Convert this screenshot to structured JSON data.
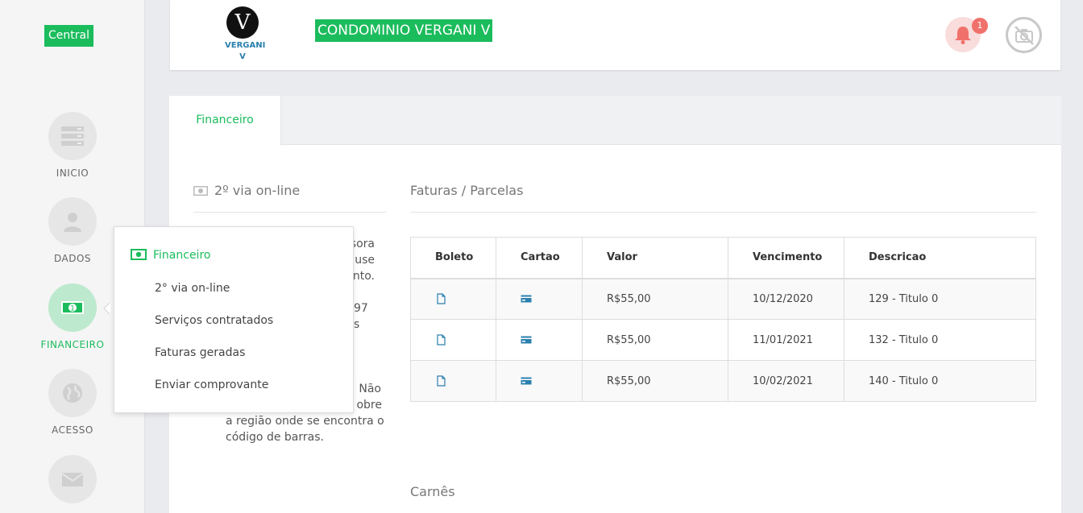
{
  "sidebar": {
    "central_label": "Central",
    "items": [
      {
        "label": "INICIO",
        "icon": "server-icon"
      },
      {
        "label": "DADOS",
        "icon": "user-icon"
      },
      {
        "label": "FINANCEIRO",
        "icon": "money-icon",
        "active": true
      },
      {
        "label": "ACESSO",
        "icon": "globe-icon"
      },
      {
        "label": "",
        "icon": "envelope-icon"
      }
    ]
  },
  "header": {
    "logo_letter": "V",
    "logo_text_1": "VERGANI",
    "logo_text_2": "V",
    "title": "CONDOMINIO VERGANI V",
    "notification_count": "1"
  },
  "tabs": [
    {
      "label": "Financeiro"
    }
  ],
  "left_panel": {
    "title": "2º via on-line",
    "text_fragment_1_line_1": "sora",
    "text_fragment_1_line_2": "use",
    "text_fragment_1_line_3": "nto.",
    "text_fragment_2_line_1": "97",
    "text_fragment_2_line_2": "s",
    "text_fragment_3_line_1": "Não",
    "text_fragment_3_line_2": "obre",
    "text_fragment_3_line_3": "a região onde se encontra o",
    "text_fragment_3_line_4": "código de barras."
  },
  "invoices": {
    "title": "Faturas / Parcelas",
    "columns": [
      "Boleto",
      "Cartao",
      "Valor",
      "Vencimento",
      "Descricao"
    ],
    "rows": [
      {
        "valor": "R$55,00",
        "vencimento": "10/12/2020",
        "descricao": "129 - Titulo 0"
      },
      {
        "valor": "R$55,00",
        "vencimento": "11/01/2021",
        "descricao": "132 - Titulo 0"
      },
      {
        "valor": "R$55,00",
        "vencimento": "10/02/2021",
        "descricao": "140 - Titulo 0"
      }
    ]
  },
  "carnes": {
    "title": "Carnês"
  },
  "popover": {
    "header": "Financeiro",
    "items": [
      "2° via on-line",
      "Serviços contratados",
      "Faturas geradas",
      "Enviar comprovante"
    ]
  },
  "colors": {
    "accent": "#1bbc5c",
    "badge": "#f0716b",
    "link_icon": "#2a7fae"
  }
}
